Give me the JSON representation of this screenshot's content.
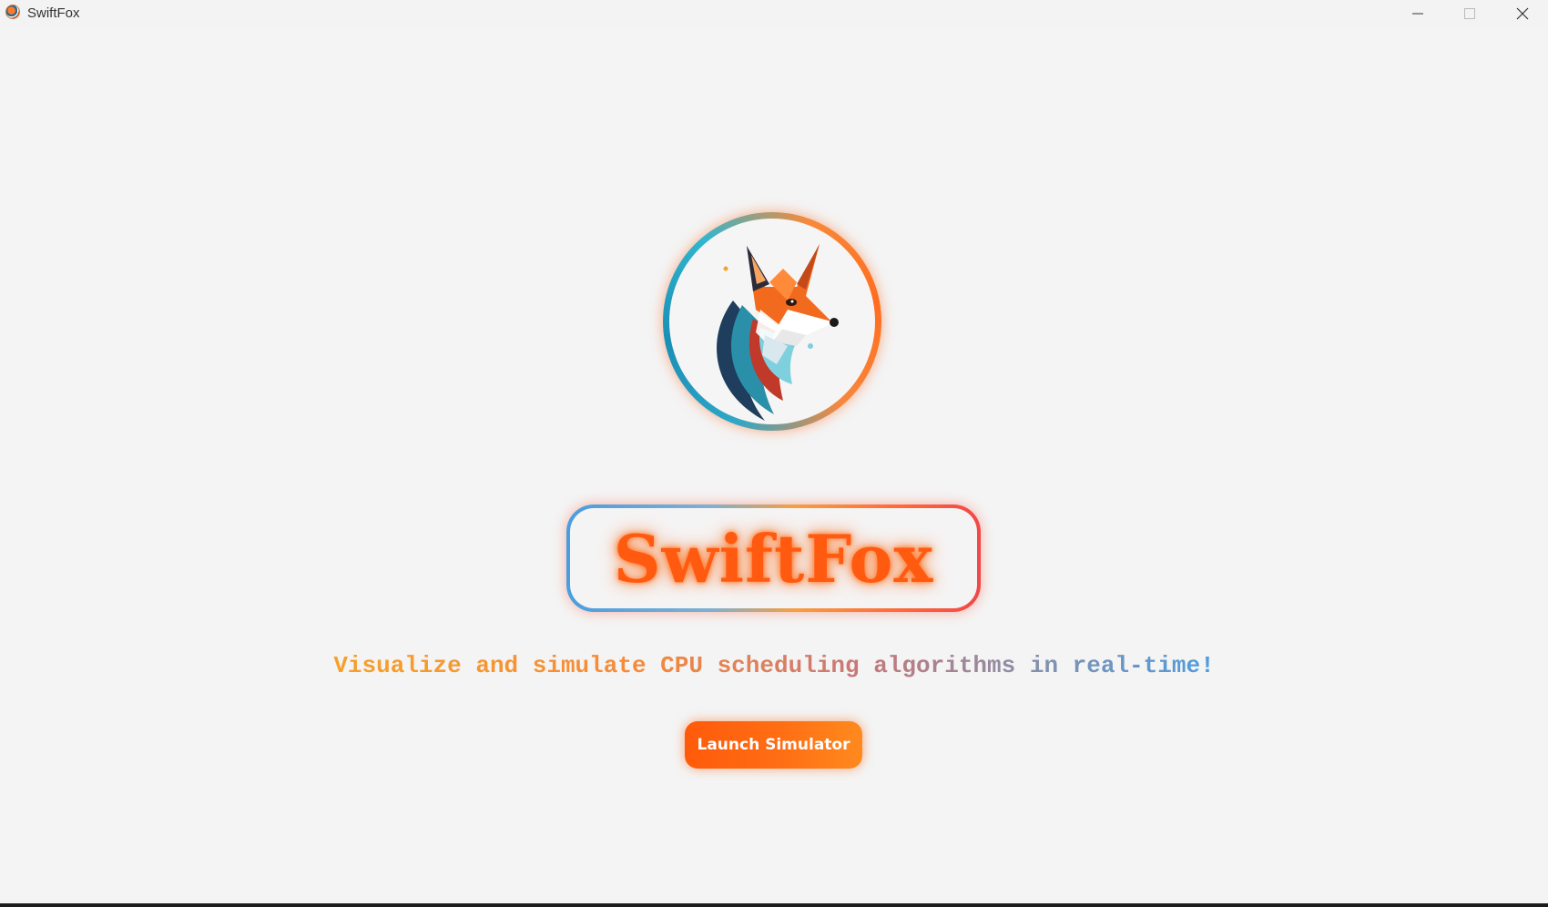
{
  "window": {
    "title": "SwiftFox",
    "controls": {
      "minimize": "minimize-icon",
      "maximize": "maximize-icon",
      "close": "close-icon"
    }
  },
  "hero": {
    "logo_icon": "fox-logo-icon",
    "title": "SwiftFox",
    "tagline": "Visualize and simulate CPU scheduling algorithms in real-time!",
    "launch_button": "Launch Simulator"
  },
  "colors": {
    "accent_orange": "#ff5a10",
    "button_start": "#ff5a0a",
    "button_end": "#ff8a1e",
    "ring_blue": "#2ea7c8",
    "title_box_blue": "#4a9de0",
    "title_box_red": "#f0484a",
    "background": "#f4f4f4"
  }
}
